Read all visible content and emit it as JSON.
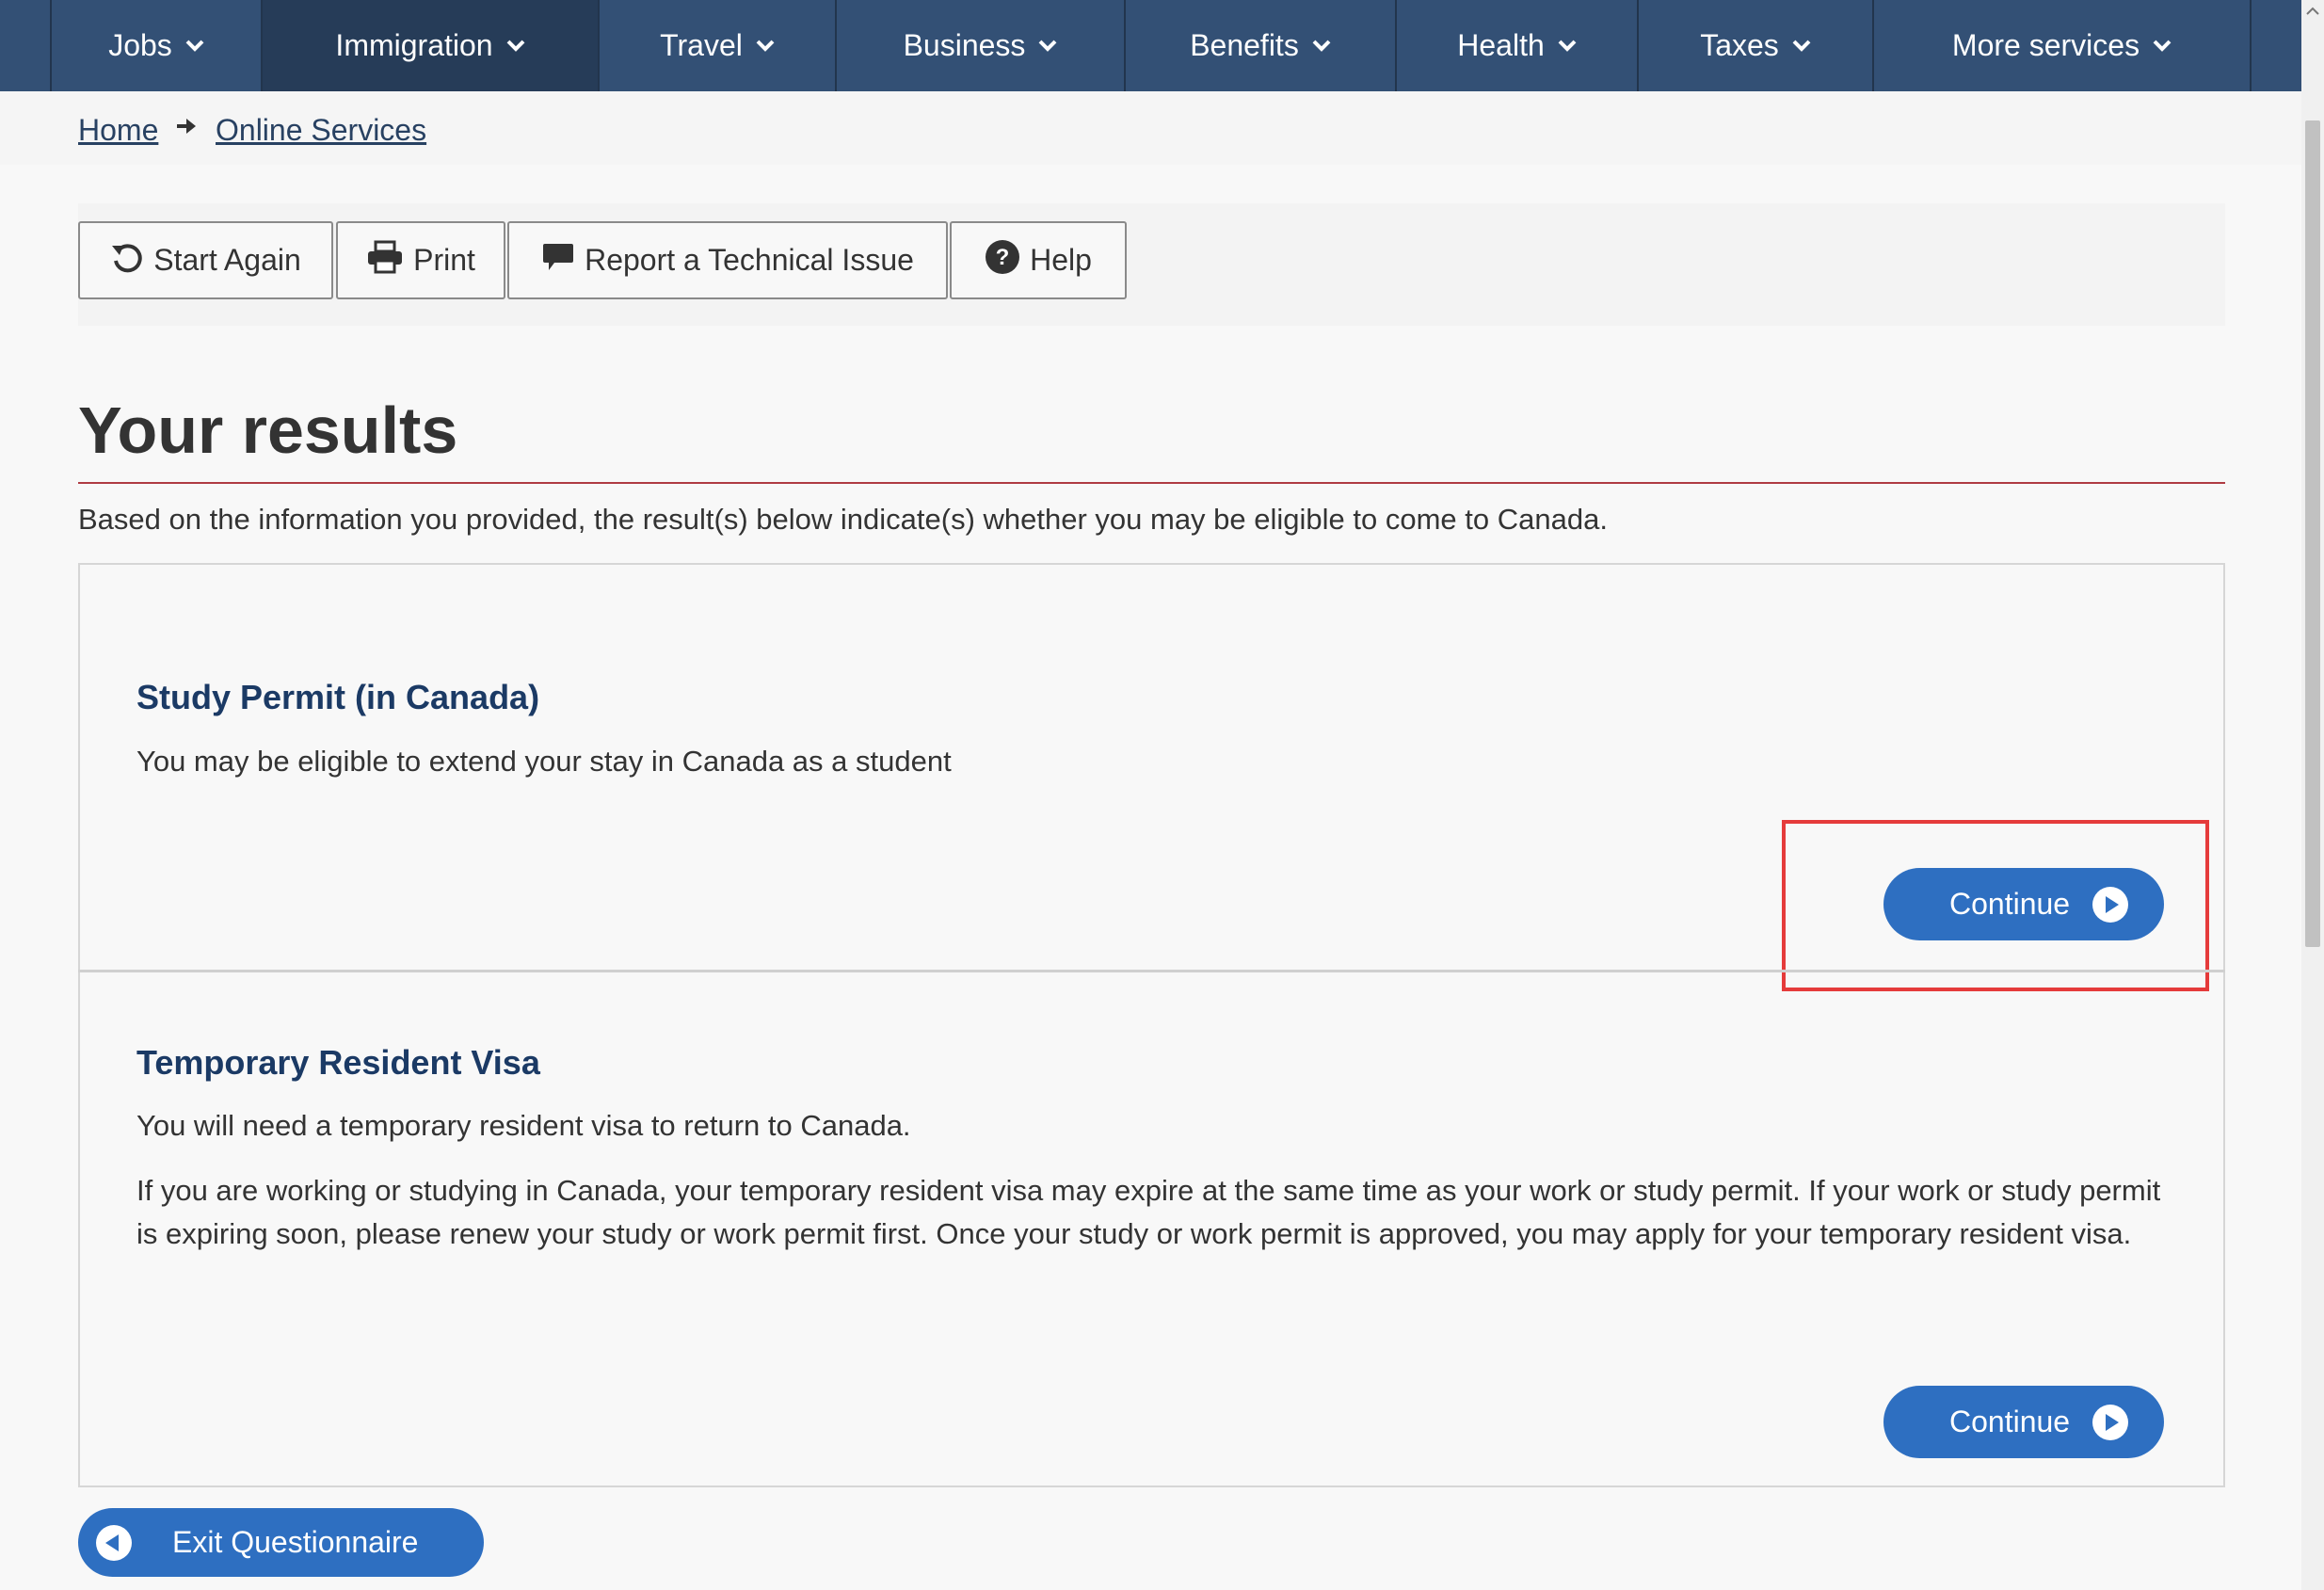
{
  "nav": {
    "items": [
      {
        "label": "Jobs"
      },
      {
        "label": "Immigration"
      },
      {
        "label": "Travel"
      },
      {
        "label": "Business"
      },
      {
        "label": "Benefits"
      },
      {
        "label": "Health"
      },
      {
        "label": "Taxes"
      },
      {
        "label": "More services"
      }
    ],
    "active_item": "Immigration",
    "chevron_icon": "chevron-down-icon"
  },
  "breadcrumb": {
    "home": "Home",
    "online_services": "Online Services",
    "separator_icon": "arrow-right-icon"
  },
  "toolbar": {
    "start_again": "Start Again",
    "print": "Print",
    "report": "Report a Technical Issue",
    "help": "Help",
    "icons": [
      "refresh-icon",
      "printer-icon",
      "comment-icon",
      "question-circle-icon"
    ]
  },
  "page": {
    "title": "Your results",
    "intro": "Based on the information you provided, the result(s) below indicate(s) whether you may be eligible to come to Canada."
  },
  "results": [
    {
      "title": "Study Permit (in Canada)",
      "text": "You may be eligible to extend your stay in Canada as a student",
      "button": "Continue"
    },
    {
      "title": "Temporary Resident Visa",
      "text": "You will need a temporary resident visa to return to Canada.",
      "text2": "If you are working or studying in Canada, your temporary resident visa may expire at the same time as your work or study permit. If your work or study permit is expiring soon, please renew your study or work permit first. Once your study or work permit is approved, you may apply for your temporary resident visa.",
      "button": "Continue"
    }
  ],
  "exit": {
    "label": "Exit Questionnaire"
  },
  "colors": {
    "nav_bg": "#335075",
    "nav_active": "#263c58",
    "button_blue": "#2e6fc1",
    "result_title": "#1b3a65",
    "title_rule": "#af3c43",
    "highlight": "#e53b3b"
  }
}
